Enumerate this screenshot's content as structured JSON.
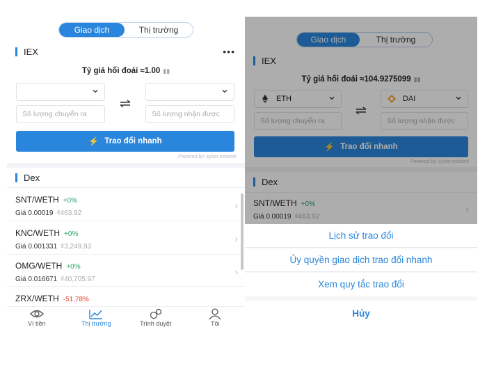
{
  "left": {
    "segments": {
      "trade": "Giao dịch",
      "market": "Thị trường"
    },
    "iex": {
      "title": "IEX",
      "more": "•••",
      "rate": "Tỷ giá hối đoái ≈1.00",
      "from_placeholder": "Số lượng chuyển ra",
      "to_placeholder": "Số lượng nhận được",
      "button": "Trao đổi nhanh",
      "powered": "Powered by: kyber.network"
    },
    "dex": {
      "title": "Dex",
      "pairs": [
        {
          "name": "SNT/WETH",
          "change": "+0%",
          "price": "Giá 0.00019",
          "fiat": "₫463.92"
        },
        {
          "name": "KNC/WETH",
          "change": "+0%",
          "price": "Giá 0.001331",
          "fiat": "₫3,249.93"
        },
        {
          "name": "OMG/WETH",
          "change": "+0%",
          "price": "Giá 0.016671",
          "fiat": "₫40,705.97"
        },
        {
          "name": "ZRX/WETH",
          "change": "-51.78%",
          "price": "",
          "fiat": ""
        }
      ]
    },
    "tabbar": [
      {
        "label": "Ví tiền",
        "icon": "wallet-icon"
      },
      {
        "label": "Thị trường",
        "icon": "market-chart-icon"
      },
      {
        "label": "Trình duyệt",
        "icon": "browser-icon"
      },
      {
        "label": "Tôi",
        "icon": "profile-icon"
      }
    ]
  },
  "right": {
    "segments": {
      "trade": "Giao dịch",
      "market": "Thị trường"
    },
    "iex": {
      "title": "IEX",
      "rate": "Tỷ giá hối đoái ≈104.9275099",
      "from_token": "ETH",
      "to_token": "DAI",
      "from_placeholder": "Số lượng chuyển ra",
      "to_placeholder": "Số lượng nhận được",
      "button": "Trao đổi nhanh",
      "powered": "Powered by: kyber.network"
    },
    "dex": {
      "title": "Dex",
      "pairs": [
        {
          "name": "SNT/WETH",
          "change": "+0%",
          "price": "Giá 0.00019",
          "fiat": "₫463.92"
        }
      ]
    },
    "sheet": {
      "items": [
        "Lịch sử trao đổi",
        "Ủy quyền giao dịch trao đổi nhanh",
        "Xem quy tắc trao đổi"
      ],
      "cancel": "Hủy"
    }
  },
  "colors": {
    "accent": "#2a86dc",
    "positive": "#25a66a",
    "negative": "#e0452f"
  }
}
